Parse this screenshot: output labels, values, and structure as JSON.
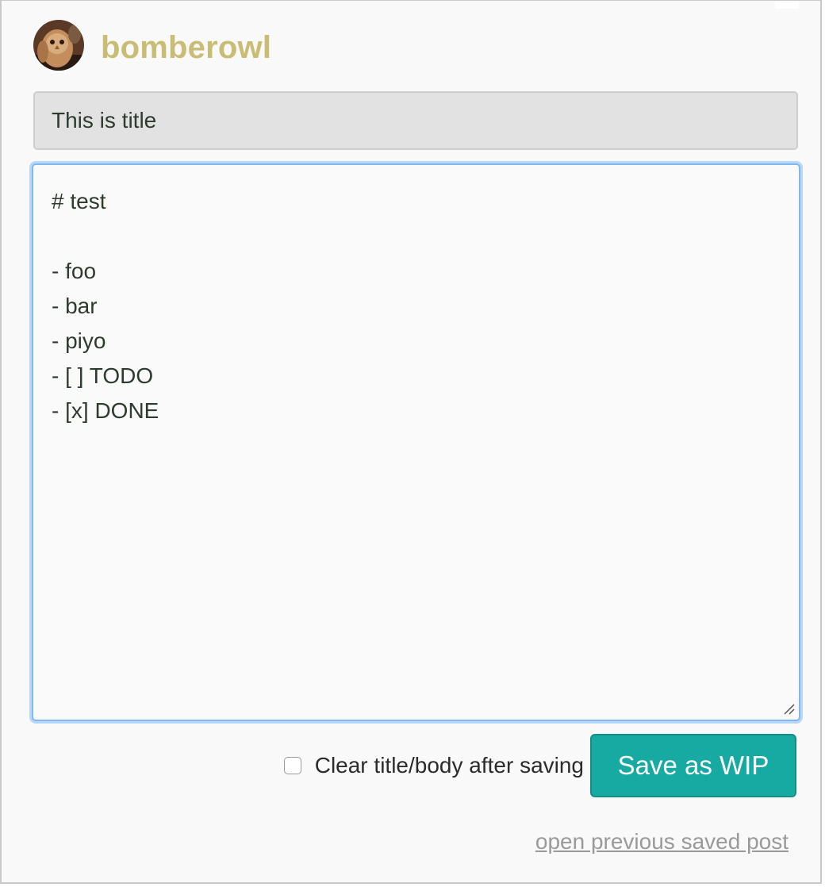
{
  "header": {
    "avatar_icon": "owl-avatar-icon",
    "username": "bomberowl",
    "username_color": "#c9bc74"
  },
  "form": {
    "title_value": "This is title",
    "body_value": "# test\n\n- foo\n- bar\n- piyo\n- [ ] TODO\n- [x] DONE",
    "clear_label": "Clear title/body after saving",
    "clear_checked": false,
    "save_button_label": "Save as WIP",
    "save_button_color": "#16aaa2"
  },
  "footer": {
    "previous_link": "open previous saved post"
  }
}
